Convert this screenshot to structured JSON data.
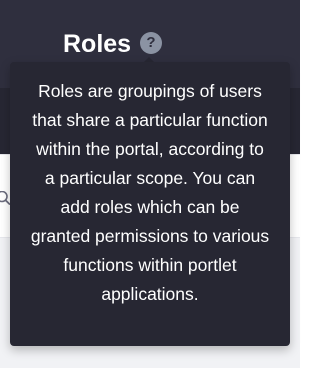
{
  "header": {
    "title": "Roles",
    "help_icon_glyph": "?",
    "help_icon": "question-circle-icon"
  },
  "toolbar": {
    "search_icon": "search-icon"
  },
  "tooltip": {
    "text": "Roles are groupings of users that share a particular function within the portal, according to a particular scope. You can add roles which can be granted permissions to various functions within portlet applications."
  },
  "colors": {
    "header_background": "#2f2f3e",
    "tooltip_background": "#272733",
    "help_icon_background": "#8b93a3",
    "content_background": "#f1f2f5"
  }
}
